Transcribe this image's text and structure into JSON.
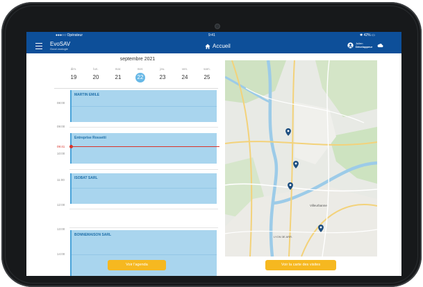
{
  "status": {
    "carrier": "●●●○○ Opérateur",
    "time": "9:41",
    "battery": "42%"
  },
  "header": {
    "app_name": "EvoSAV",
    "app_subtitle": "Good zoologie",
    "home_label": "Accueil",
    "user_name": "Julien",
    "user_role": "Développeur"
  },
  "calendar": {
    "month_label": "septembre 2021",
    "days": [
      {
        "name": "dim.",
        "number": "19"
      },
      {
        "name": "lun.",
        "number": "20"
      },
      {
        "name": "mar.",
        "number": "21"
      },
      {
        "name": "mer.",
        "number": "22"
      },
      {
        "name": "jeu.",
        "number": "23"
      },
      {
        "name": "ven.",
        "number": "24"
      },
      {
        "name": "sam.",
        "number": "25"
      }
    ],
    "selected_day_index": 3,
    "hours": [
      "08:00",
      "09:00",
      "10:00",
      "11:00",
      "12:00",
      "13:00",
      "14:00"
    ],
    "current_time": "09:41",
    "events": [
      {
        "title": "MARTIN EMILE"
      },
      {
        "title": "Entreprise Rossetti"
      },
      {
        "title": "ISOBAT SARL"
      },
      {
        "title": "BONNEMAISON SARL"
      }
    ]
  },
  "map": {
    "labels": [
      "Villeurbanne",
      "LYON 3E ARR."
    ],
    "marker_color": "#1e4f80",
    "markers_count": 5
  },
  "actions": {
    "agenda_button": "Voir l'agenda",
    "map_button": "Voir la carte des visites"
  },
  "colors": {
    "appbar": "#0d4f99",
    "accent": "#f6b820",
    "event": "#a9d5ee",
    "now": "#d9342b"
  }
}
